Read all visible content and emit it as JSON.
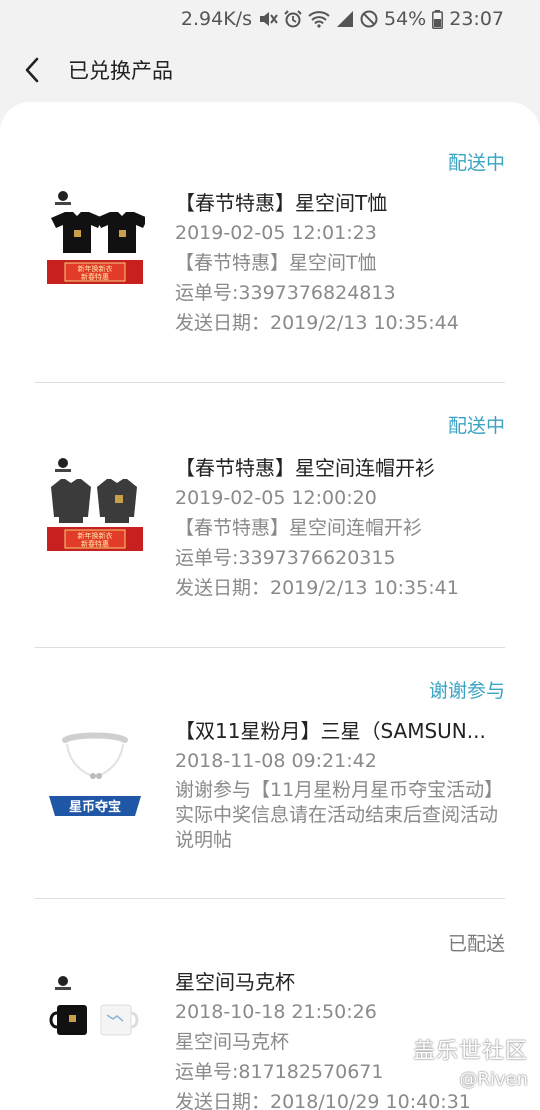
{
  "status_bar": {
    "speed": "2.94K/s",
    "battery_percent": "54%",
    "time": "23:07",
    "icons": [
      "mute-icon",
      "alarm-icon",
      "wifi-icon",
      "signal-icon",
      "block-icon",
      "battery-icon"
    ]
  },
  "header": {
    "title": "已兑换产品"
  },
  "colors": {
    "status_active": "#3aa3c4",
    "status_done": "#7a7a7a",
    "background": "#f2f2f2",
    "card": "#ffffff"
  },
  "orders": [
    {
      "status": "配送中",
      "title": "【春节特惠】星空间T恤",
      "date": "2019-02-05 12:01:23",
      "subtitle": "【春节特惠】星空间T恤",
      "tracking": "运单号:3397376824813",
      "ship_date": "发送日期：2019/2/13 10:35:44",
      "thumb_banner_line1": "新年换新衣",
      "thumb_banner_line2": "新春特惠"
    },
    {
      "status": "配送中",
      "title": "【春节特惠】星空间连帽开衫",
      "date": "2019-02-05 12:00:20",
      "subtitle": "【春节特惠】星空间连帽开衫",
      "tracking": "运单号:3397376620315",
      "ship_date": "发送日期：2019/2/13 10:35:41",
      "thumb_banner_line1": "新年换新衣",
      "thumb_banner_line2": "新春特惠"
    },
    {
      "status": "谢谢参与",
      "title": "【双11星粉月】三星（SAMSUN...",
      "date": "2018-11-08 09:21:42",
      "description": "谢谢参与【11月星粉月星币夺宝活动】实际中奖信息请在活动结束后查阅活动说明帖",
      "thumb_banner": "星币夺宝"
    },
    {
      "status": "已配送",
      "title": "星空间马克杯",
      "date": "2018-10-18 21:50:26",
      "subtitle": "星空间马克杯",
      "tracking": "运单号:817182570671",
      "ship_date": "发送日期：2018/10/29 10:40:31"
    }
  ],
  "watermark": {
    "line1": "盖乐世社区",
    "line2": "@Riven"
  }
}
